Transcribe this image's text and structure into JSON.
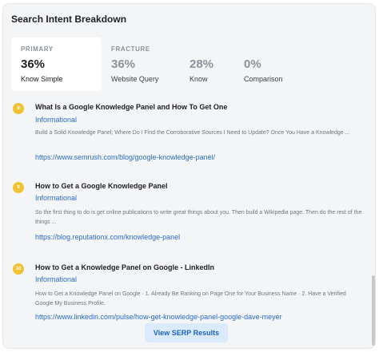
{
  "panel": {
    "title": "Search Intent Breakdown"
  },
  "intent_tabs": [
    {
      "caption": "PRIMARY",
      "percent": "36%",
      "label": "Know Simple",
      "active": true
    },
    {
      "caption": "FRACTURE",
      "percent": "36%",
      "label": "Website Query",
      "active": false
    },
    {
      "caption": "",
      "percent": "28%",
      "label": "Know",
      "active": false
    },
    {
      "caption": "",
      "percent": "0%",
      "label": "Comparison",
      "active": false
    }
  ],
  "results": [
    {
      "rank": "8",
      "title": "What Is a Google Knowledge Panel and How To Get One",
      "intent": "Informational",
      "snippet": "Build a Solid Knowledge Panel; Where Do I Find the Corroborative Sources I Need to Update? Once You Have a Knowledge ...",
      "url": "https://www.semrush.com/blog/google-knowledge-panel/"
    },
    {
      "rank": "9",
      "title": "How to Get a Google Knowledge Panel",
      "intent": "Informational",
      "snippet": "So the first thing to do is get online publications to write great things about you. Then build a Wikipedia page. Then do the rest of the things ...",
      "url": "https://blog.reputationx.com/knowledge-panel"
    },
    {
      "rank": "10",
      "title": "How to Get a Knowledge Panel on Google - LinkedIn",
      "intent": "Informational",
      "snippet": "How to Get a Knowledge Panel on Google · 1. Already Be Ranking on Page One for Your Business Name · 2. Have a Verified Google My Business Profile.",
      "url": "https://www.linkedin.com/pulse/how-get-knowledge-panel-google-dave-meyer"
    }
  ],
  "button": {
    "label": "View SERP Results"
  },
  "colors": {
    "badge": "#f2c232",
    "link": "#2a6bc5",
    "button_bg": "#dcebfb"
  }
}
